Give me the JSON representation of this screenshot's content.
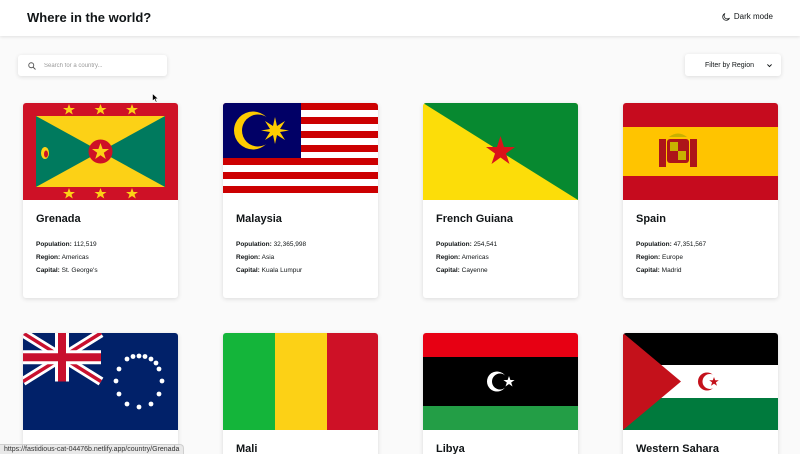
{
  "header": {
    "title": "Where in the world?",
    "mode_label": "Dark mode"
  },
  "search": {
    "placeholder": "Search for a country..."
  },
  "filter": {
    "label": "Filter by Region"
  },
  "labels": {
    "population": "Population:",
    "region": "Region:",
    "capital": "Capital:"
  },
  "countries": [
    {
      "name": "Grenada",
      "population": "112,519",
      "region": "Americas",
      "capital": "St. George's",
      "flag": "grenada-flag"
    },
    {
      "name": "Malaysia",
      "population": "32,365,998",
      "region": "Asia",
      "capital": "Kuala Lumpur",
      "flag": "malaysia-flag"
    },
    {
      "name": "French Guiana",
      "population": "254,541",
      "region": "Americas",
      "capital": "Cayenne",
      "flag": "french-guiana-flag"
    },
    {
      "name": "Spain",
      "population": "47,351,567",
      "region": "Europe",
      "capital": "Madrid",
      "flag": "spain-flag"
    },
    {
      "name": "",
      "flag": "cook-islands-flag"
    },
    {
      "name": "Mali",
      "flag": "mali-flag"
    },
    {
      "name": "Libya",
      "flag": "libya-flag"
    },
    {
      "name": "Western Sahara",
      "flag": "western-sahara-flag"
    }
  ],
  "status_bar": {
    "url": "https://fastidious-cat-04476b.netlify.app/country/Grenada"
  },
  "colors": {
    "background": "#fafafa",
    "card": "#ffffff",
    "text": "#111517"
  }
}
